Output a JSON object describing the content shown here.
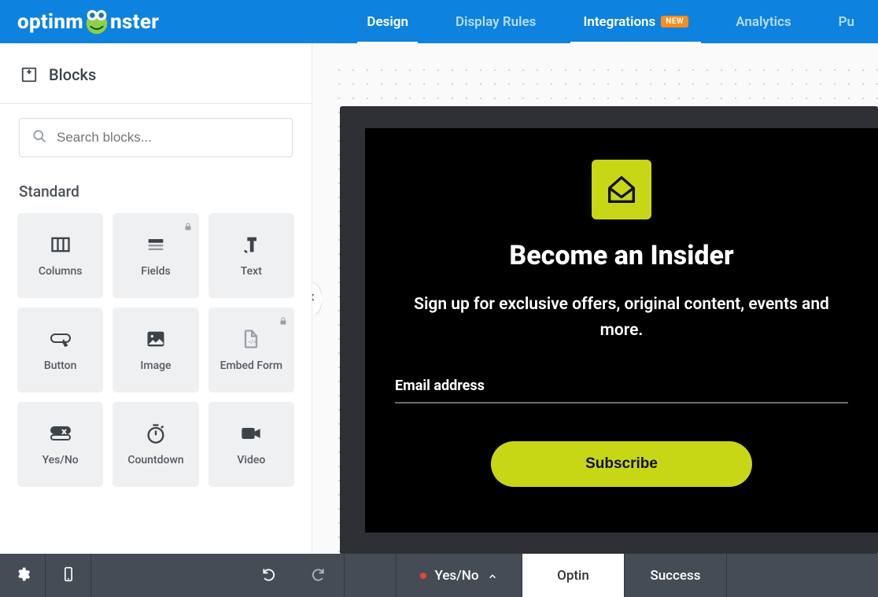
{
  "brand": {
    "name1": "optinm",
    "name2": "nster"
  },
  "topnav": {
    "design": "Design",
    "display_rules": "Display Rules",
    "integrations": "Integrations",
    "integrations_badge": "NEW",
    "analytics": "Analytics",
    "publish": "Pu"
  },
  "sidebar": {
    "title": "Blocks",
    "search_placeholder": "Search blocks...",
    "section": "Standard",
    "blocks": [
      {
        "label": "Columns",
        "locked": false
      },
      {
        "label": "Fields",
        "locked": true
      },
      {
        "label": "Text",
        "locked": false
      },
      {
        "label": "Button",
        "locked": false
      },
      {
        "label": "Image",
        "locked": false
      },
      {
        "label": "Embed Form",
        "locked": true
      },
      {
        "label": "Yes/No",
        "locked": false
      },
      {
        "label": "Countdown",
        "locked": false
      },
      {
        "label": "Video",
        "locked": false
      }
    ]
  },
  "preview": {
    "heading": "Become an Insider",
    "subheading": "Sign up for exclusive offers, original content, events and more.",
    "email_label": "Email address",
    "cta": "Subscribe"
  },
  "bottombar": {
    "yesno": "Yes/No",
    "optin": "Optin",
    "success": "Success"
  },
  "colors": {
    "topbar": "#0d82df",
    "accent": "#c7d716",
    "badge": "#ff8c1a",
    "bottombar": "#464c55"
  }
}
